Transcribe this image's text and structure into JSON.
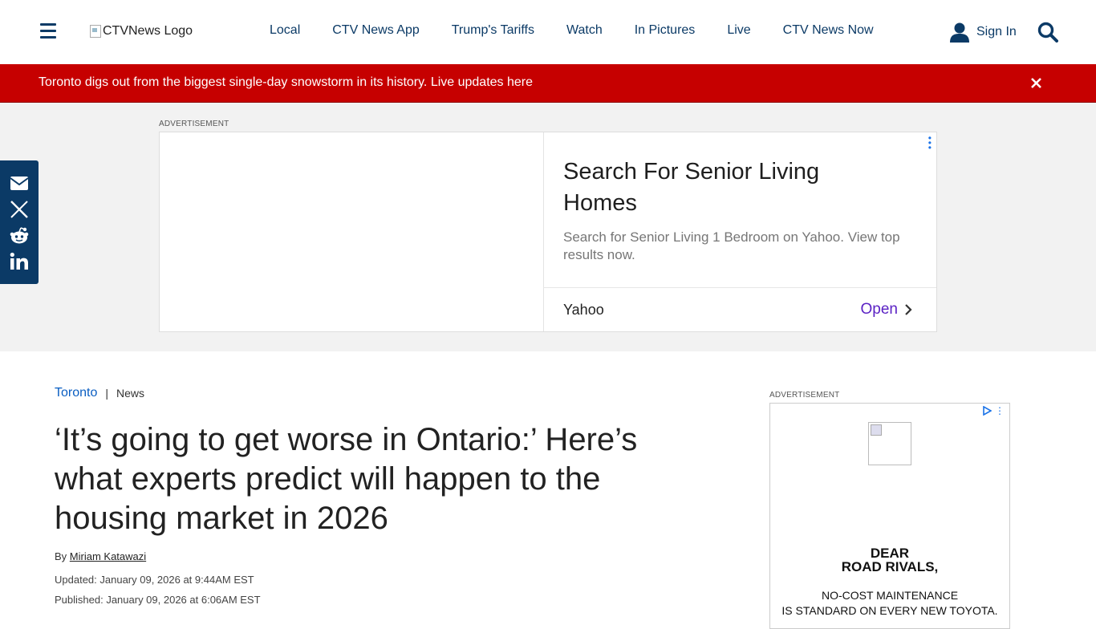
{
  "header": {
    "logo_alt": "CTVNews Logo",
    "nav": [
      "Local",
      "CTV News App",
      "Trump's Tariffs",
      "Watch",
      "In Pictures",
      "Live",
      "CTV News Now"
    ],
    "sign_in": "Sign In"
  },
  "alert": {
    "text": "Toronto digs out from the biggest single-day snowstorm in its history. Live updates here"
  },
  "top_ad": {
    "label": "ADVERTISEMENT",
    "headline": "Search For Senior Living Homes",
    "description": "Search for Senior Living 1 Bedroom on Yahoo. View top results now.",
    "brand": "Yahoo",
    "cta": "Open"
  },
  "share": {
    "icons": [
      "email-icon",
      "x-icon",
      "reddit-icon",
      "linkedin-icon"
    ]
  },
  "article": {
    "section": "Toronto",
    "separator": "|",
    "category": "News",
    "title": "‘It’s going to get worse in Ontario:’ Here’s what experts predict will happen to the housing market in 2026",
    "by_prefix": "By",
    "author": "Miriam Katawazi",
    "updated": "Updated: January 09, 2026 at 9:44AM EST",
    "published": "Published: January 09, 2026 at 6:06AM EST"
  },
  "side_ad": {
    "label": "ADVERTISEMENT",
    "line1": "DEAR",
    "line2": "ROAD RIVALS,",
    "small1": "NO-COST MAINTENANCE",
    "small2": "IS STANDARD ON EVERY NEW TOYOTA."
  },
  "colors": {
    "brand_navy": "#0b3a66",
    "alert_red": "#c60000",
    "link_blue": "#0a5ec2",
    "ad_cta_purple": "#5b22c4"
  }
}
